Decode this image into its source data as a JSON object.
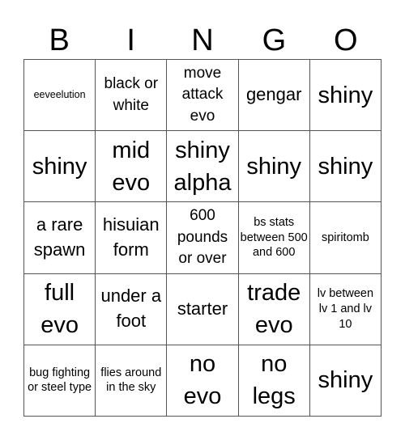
{
  "header": {
    "letters": [
      "B",
      "I",
      "N",
      "G",
      "O"
    ]
  },
  "board": {
    "cells": [
      [
        "eeveelution",
        "black or white",
        "move attack evo",
        "gengar",
        "shiny"
      ],
      [
        "shiny",
        "mid evo",
        "shiny alpha",
        "shiny",
        "shiny"
      ],
      [
        "a rare spawn",
        "hisuian form",
        "600 pounds or over",
        "bs stats between 500 and 600",
        "spiritomb"
      ],
      [
        "full evo",
        "under a foot",
        "starter",
        "trade evo",
        "lv between lv 1 and lv 10"
      ],
      [
        "bug fighting or steel type",
        "flies around in the sky",
        "no evo",
        "no legs",
        "shiny"
      ]
    ]
  }
}
